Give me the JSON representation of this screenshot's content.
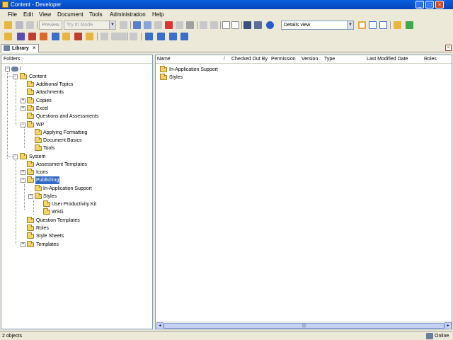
{
  "window": {
    "title": "Content - Developer",
    "controls": {
      "minimize": "_",
      "maximize": "□",
      "close": "×"
    }
  },
  "menu": [
    "File",
    "Edit",
    "View",
    "Document",
    "Tools",
    "Administration",
    "Help"
  ],
  "toolbar": {
    "preview_label": "Preview",
    "mode_select": "Try It! Mode",
    "view_select": "Details view"
  },
  "library_tab": {
    "label": "Library",
    "close": "×"
  },
  "folders_header": "Folders",
  "tree": {
    "root_label": "/",
    "content": "Content",
    "additional_topics": "Additional Topics",
    "attachments": "Attachments",
    "copies": "Copies",
    "excel": "Excel",
    "questions_and_assessments": "Questions and Assessments",
    "wp": "WP",
    "applying_formatting": "Applying Formatting",
    "document_basics": "Document Basics",
    "tools": "Tools",
    "system": "System",
    "assessment_templates": "Assessment Templates",
    "icons": "Icons",
    "publishing": "Publishing",
    "in_application_support": "In-Application Support",
    "styles": "Styles",
    "user_productivity_kit": "User Productivity Kit",
    "wsg": "WSG",
    "question_templates": "Question Templates",
    "roles": "Roles",
    "style_sheets": "Style Sheets",
    "templates": "Templates"
  },
  "details": {
    "columns": [
      "Name",
      "Checked Out By",
      "Permission",
      "Version",
      "Type",
      "Last Modified Date",
      "Roles"
    ],
    "sort_indicator": "/",
    "items": [
      "In-Application Support",
      "Styles"
    ]
  },
  "status": {
    "count": "2 objects",
    "connection": "Online"
  },
  "colors": {
    "titlebar": "#0544b8",
    "selection": "#316ac5",
    "folder": "#f4d46a"
  }
}
